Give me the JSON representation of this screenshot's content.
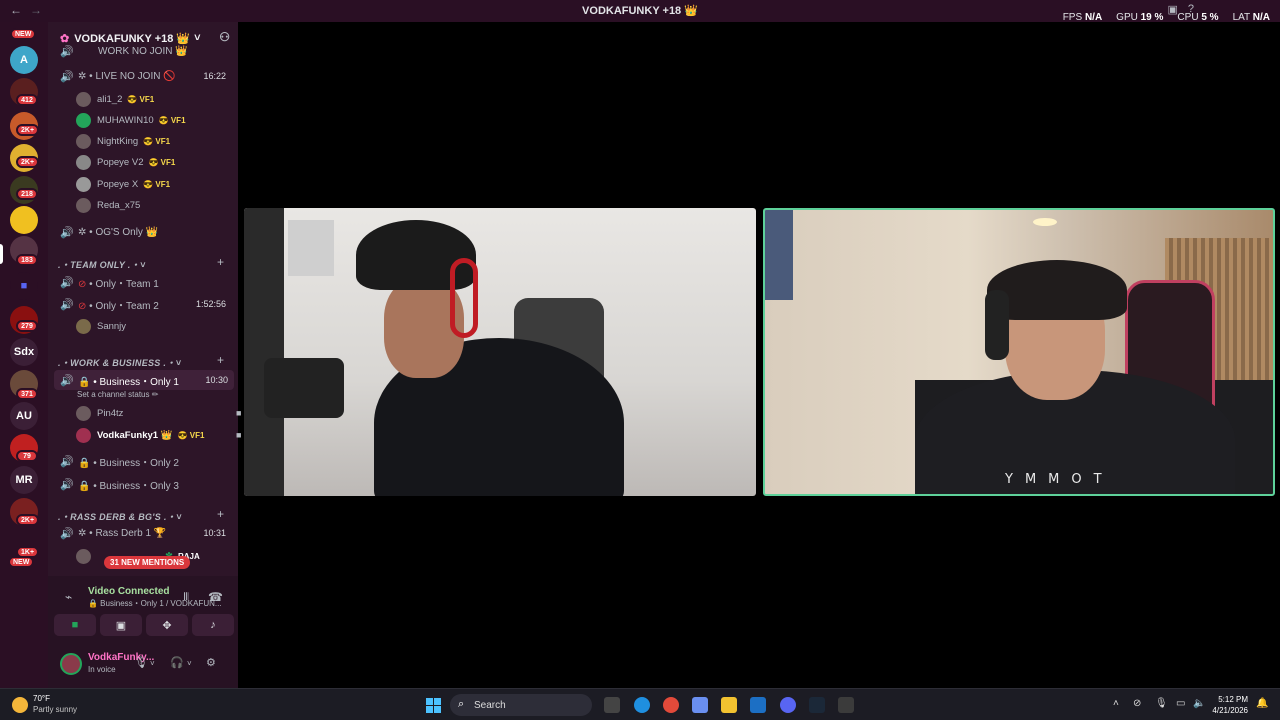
{
  "titlebar": {
    "title": "VODKAFUNKY +18 👑",
    "fps_label": "FPS",
    "fps_value": "N/A",
    "gpu_label": "GPU",
    "gpu_value": "19 %",
    "cpu_label": "CPU",
    "cpu_value": "5 %",
    "lat_label": "LAT",
    "lat_value": "N/A"
  },
  "rail": {
    "badges": [
      "NEW",
      "412",
      "2K+",
      "2K+",
      "218",
      "183",
      "279",
      "371",
      "79",
      "2K+",
      "1K+",
      "NEW"
    ],
    "text_servers": [
      "Sdx",
      "AU",
      "MR"
    ]
  },
  "server": {
    "name": "VODKAFUNKY +18 👑",
    "channels": {
      "work_no_join": "WORK NO JOIN 👑",
      "live_no_join": "LIVE NO JOIN 🚫",
      "live_no_join_time": "16:22",
      "ogs_only": "OG'S Only 👑",
      "team1": "Only・Team 1",
      "team2": "Only・Team 2",
      "team2_time": "1:52:56",
      "business1": "Business・Only 1",
      "business1_time": "10:30",
      "business1_status": "Set a channel status ✏",
      "business2": "Business・Only 2",
      "business3": "Business・Only 3",
      "rass": "Rass Derb 1 🏆",
      "rass_time": "10:31"
    },
    "categories": {
      "team_only": ".・TEAM ONLY .・˅",
      "work_business": ".・WORK & BUSINESS .・˅",
      "rass_derb": ".・RASS DERB & BG'S .・˅"
    },
    "users": {
      "u1": "ali1_2",
      "u2": "MUHAWIN10",
      "u3": "NightKing",
      "u4": "Popeye V2",
      "u5": "Popeye X",
      "u6": "Reda_x75",
      "u7": "Sannjy",
      "u8": "Pin4tz",
      "u9": "VodkaFunky1 👑",
      "u10": "RAJA",
      "tag": "😎 VF1"
    },
    "mentions": "31 NEW MENTIONS"
  },
  "voice": {
    "title": "Video Connected",
    "subtitle": "🔒 Business・Only 1 / VODKAFUN...",
    "me_name": "VodkaFunky...",
    "me_status": "In voice"
  },
  "video": {
    "shirt_text": "YMMOT"
  },
  "taskbar": {
    "temp": "70°F",
    "condition": "Partly sunny",
    "search_label": "Search",
    "time": "5:12 PM",
    "date": "4/21/2026"
  }
}
